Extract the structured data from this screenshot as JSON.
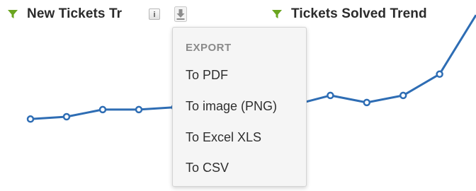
{
  "widgets": {
    "left": {
      "title": "New Tickets Tr",
      "filter_icon": "funnel-icon",
      "info_icon": "info-icon",
      "info_glyph": "i",
      "export_icon": "download-arrow-icon"
    },
    "right": {
      "title": "Tickets Solved Trend",
      "filter_icon": "funnel-icon"
    }
  },
  "export_menu": {
    "heading": "EXPORT",
    "items": [
      {
        "label": "To PDF"
      },
      {
        "label": "To image (PNG)"
      },
      {
        "label": "To Excel XLS"
      },
      {
        "label": "To CSV"
      }
    ]
  },
  "colors": {
    "filter_green": "#6aa51f",
    "line_blue": "#2e6db4",
    "menu_bg": "#f5f5f5",
    "title_text": "#2b2b2b"
  },
  "chart_data": [
    {
      "type": "line",
      "title": "New Tickets Tr",
      "x": [
        1,
        2,
        3,
        4,
        5
      ],
      "series": [
        {
          "values": [
            1.0,
            1.2,
            1.8,
            1.8,
            2.0
          ]
        }
      ],
      "ylim": [
        0,
        10
      ]
    },
    {
      "type": "line",
      "title": "Tickets Solved Trend",
      "x": [
        1,
        2,
        3,
        4,
        5,
        6
      ],
      "series": [
        {
          "values": [
            2.2,
            3.0,
            2.4,
            3.0,
            4.8,
            9.8
          ]
        }
      ],
      "ylim": [
        0,
        10
      ]
    }
  ]
}
